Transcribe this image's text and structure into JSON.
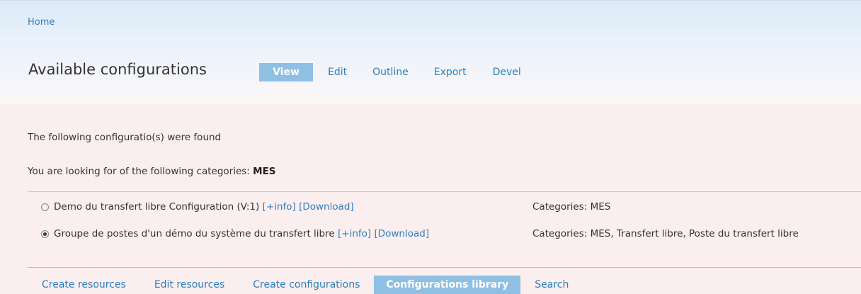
{
  "breadcrumb": {
    "home": "Home"
  },
  "header": {
    "title": "Available configurations",
    "tabs": [
      {
        "label": "View",
        "active": true
      },
      {
        "label": "Edit",
        "active": false
      },
      {
        "label": "Outline",
        "active": false
      },
      {
        "label": "Export",
        "active": false
      },
      {
        "label": "Devel",
        "active": false
      }
    ]
  },
  "main": {
    "found_text": "The following configuratio(s) were found",
    "categories_prefix": "You are looking for of the following categories:",
    "categories_value": "MES",
    "configurations": [
      {
        "name": "Demo du transfert libre Configuration (V:1)",
        "info_link": "[+info]",
        "download_link": "[Download]",
        "categories": "Categories: MES",
        "selected": false
      },
      {
        "name": "Groupe de postes d'un démo du système du transfert libre",
        "info_link": "[+info]",
        "download_link": "[Download]",
        "categories": "Categories: MES, Transfert libre, Poste du transfert libre",
        "selected": true
      }
    ]
  },
  "bottom_nav": {
    "items": [
      {
        "label": "Create resources",
        "active": false
      },
      {
        "label": "Edit resources",
        "active": false
      },
      {
        "label": "Create configurations",
        "active": false
      },
      {
        "label": "Configurations library",
        "active": true
      },
      {
        "label": "Search",
        "active": false
      }
    ]
  },
  "colors": {
    "link": "#2b7fbf",
    "active_tab_bg": "#8fbfe3",
    "content_bg": "#fbeeee"
  }
}
